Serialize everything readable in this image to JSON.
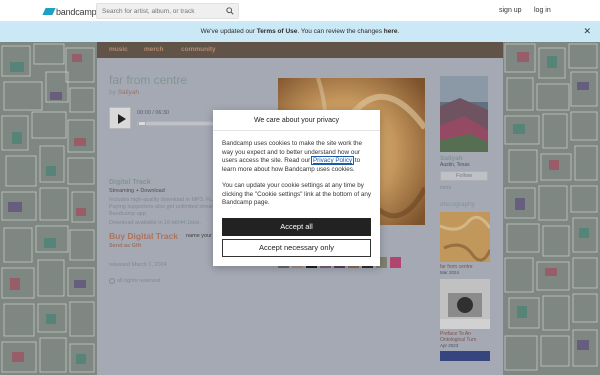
{
  "header": {
    "logo_text": "bandcamp",
    "search": {
      "placeholder": "Search for artist, album, or track"
    },
    "signup": "sign up",
    "login": "log in"
  },
  "notice": {
    "prefix": "We've updated our ",
    "terms": "Terms of Use",
    "middle": ". You can review the changes ",
    "here": "here",
    "suffix": "."
  },
  "nav": {
    "music": "music",
    "merch": "merch",
    "community": "community"
  },
  "track": {
    "title": "far from centre",
    "by": "by",
    "artist": "Saliyah",
    "time": "00:00 / 06:30",
    "progress": 0,
    "digital_track": "Digital Track",
    "streaming": "Streaming + Download",
    "desc1": "Includes high-quality download in MP3, FLAC and more.",
    "desc2": "Paying supporters also get unlimited streaming via the free",
    "desc3": "Bandcamp app.",
    "download_note": "Download available in 16-bit/44.1kHz.",
    "buy": "Buy Digital Track",
    "name_price": "name your price",
    "gift": "Send as Gift",
    "released": "released March 1, 2024",
    "rights": "all rights reserved"
  },
  "sidebar": {
    "artist": "Saliyah",
    "location": "Austin, Texas",
    "follow": "Follow",
    "more": "more",
    "discography": "discography",
    "album1": "far from centre",
    "album1_date": "Mar 2024",
    "album2_line1": "Preface To An",
    "album2_line2": "Ontological Turn",
    "album2_date": "Apr 2023"
  },
  "modal": {
    "title": "We care about your privacy",
    "p1_before": "Bandcamp uses cookies to make the site work the way you expect and to better understand how our users access the site. Read our ",
    "p1_link": "Privacy Policy",
    "p1_after": " to learn more about how Bandcamp uses cookies.",
    "p2": "You can update your cookie settings at any time by clicking the \"Cookie settings\" link at the bottom of any Bandcamp page.",
    "accept_all": "Accept all",
    "accept_necessary": "Accept necessary only"
  },
  "colors": {
    "nav_bg": "#6b5a4f",
    "link": "#b07f6a",
    "text_teal": "#8fa5a3",
    "content_bg": "#b8bcc9",
    "notice_bg": "#cbe8f7",
    "logo_accent": "#1da0c3"
  }
}
